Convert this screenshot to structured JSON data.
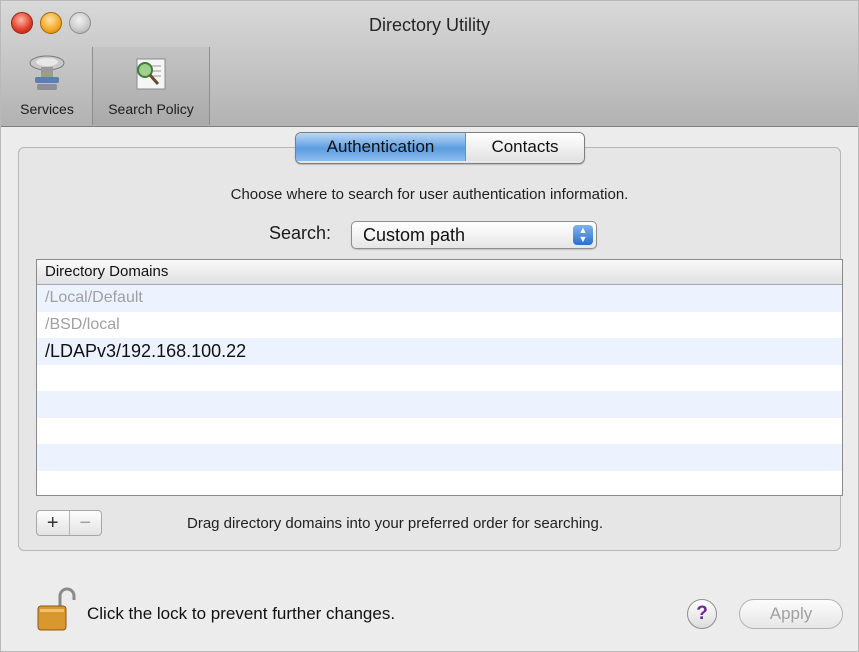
{
  "window": {
    "title": "Directory Utility"
  },
  "toolbar": {
    "items": [
      {
        "label": "Services",
        "icon": "services-icon"
      },
      {
        "label": "Search Policy",
        "icon": "search-policy-icon"
      }
    ]
  },
  "tabs": [
    {
      "label": "Authentication",
      "selected": true
    },
    {
      "label": "Contacts",
      "selected": false
    }
  ],
  "main": {
    "instruction": "Choose where to search for user authentication information.",
    "search_label": "Search:",
    "search_value": "Custom path",
    "table": {
      "header": "Directory Domains",
      "rows": [
        {
          "value": "/Local/Default",
          "enabled": false
        },
        {
          "value": "/BSD/local",
          "enabled": false
        },
        {
          "value": "/LDAPv3/192.168.100.22",
          "enabled": true
        }
      ]
    },
    "add_label": "+",
    "remove_label": "−",
    "hint": "Drag directory domains into your preferred order for searching."
  },
  "footer": {
    "lock_text": "Click the lock to prevent further changes.",
    "help_label": "?",
    "apply_label": "Apply"
  },
  "colors": {
    "accent_tab": "#5d9de0",
    "row_stripe": "#edf3fe",
    "help_mark": "#6a2c93"
  }
}
